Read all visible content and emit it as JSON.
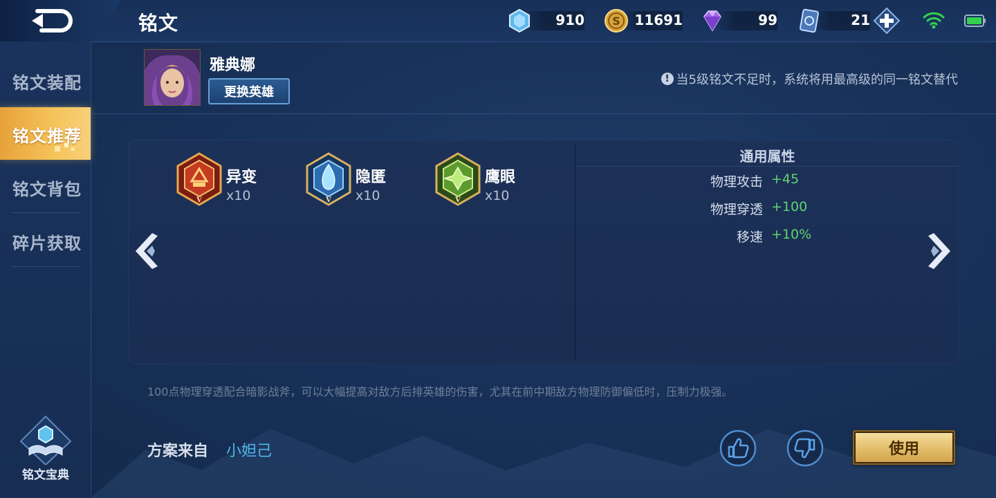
{
  "topbar": {
    "title": "铭文",
    "resources": [
      {
        "icon": "crystal-icon",
        "value": "910"
      },
      {
        "icon": "gold-coin-icon",
        "value": "11691"
      },
      {
        "icon": "diamond-icon",
        "value": "99"
      },
      {
        "icon": "card-voucher-icon",
        "value": "21"
      }
    ]
  },
  "sidebar": {
    "items": [
      {
        "label": "铭文装配",
        "active": false
      },
      {
        "label": "铭文推荐",
        "active": true
      },
      {
        "label": "铭文背包",
        "active": false
      },
      {
        "label": "碎片获取",
        "active": false
      }
    ],
    "codex_label": "铭文宝典"
  },
  "hero": {
    "name": "雅典娜",
    "change_button": "更换英雄",
    "notice": "当5级铭文不足时，系统将用最高级的同一铭文替代"
  },
  "runes": [
    {
      "name": "异变",
      "count": "x10",
      "color": "#c0392b"
    },
    {
      "name": "隐匿",
      "count": "x10",
      "color": "#3b8bd4"
    },
    {
      "name": "鹰眼",
      "count": "x10",
      "color": "#6aa43a"
    }
  ],
  "attributes": {
    "title": "通用属性",
    "rows": [
      {
        "name": "物理攻击",
        "value": "+45"
      },
      {
        "name": "物理穿透",
        "value": "+100"
      },
      {
        "name": "移速",
        "value": "+10%"
      }
    ]
  },
  "description": "100点物理穿透配合暗影战斧，可以大幅提高对敌方后排英雄的伤害，尤其在前中期敌方物理防御偏低时，压制力极强。",
  "footer": {
    "source_label": "方案来自",
    "source_author": "小妲己",
    "use_button": "使用"
  },
  "colors": {
    "accent_gold": "#f5c45a",
    "attr_green": "#5fd36f",
    "author_blue": "#4fb6ea"
  }
}
